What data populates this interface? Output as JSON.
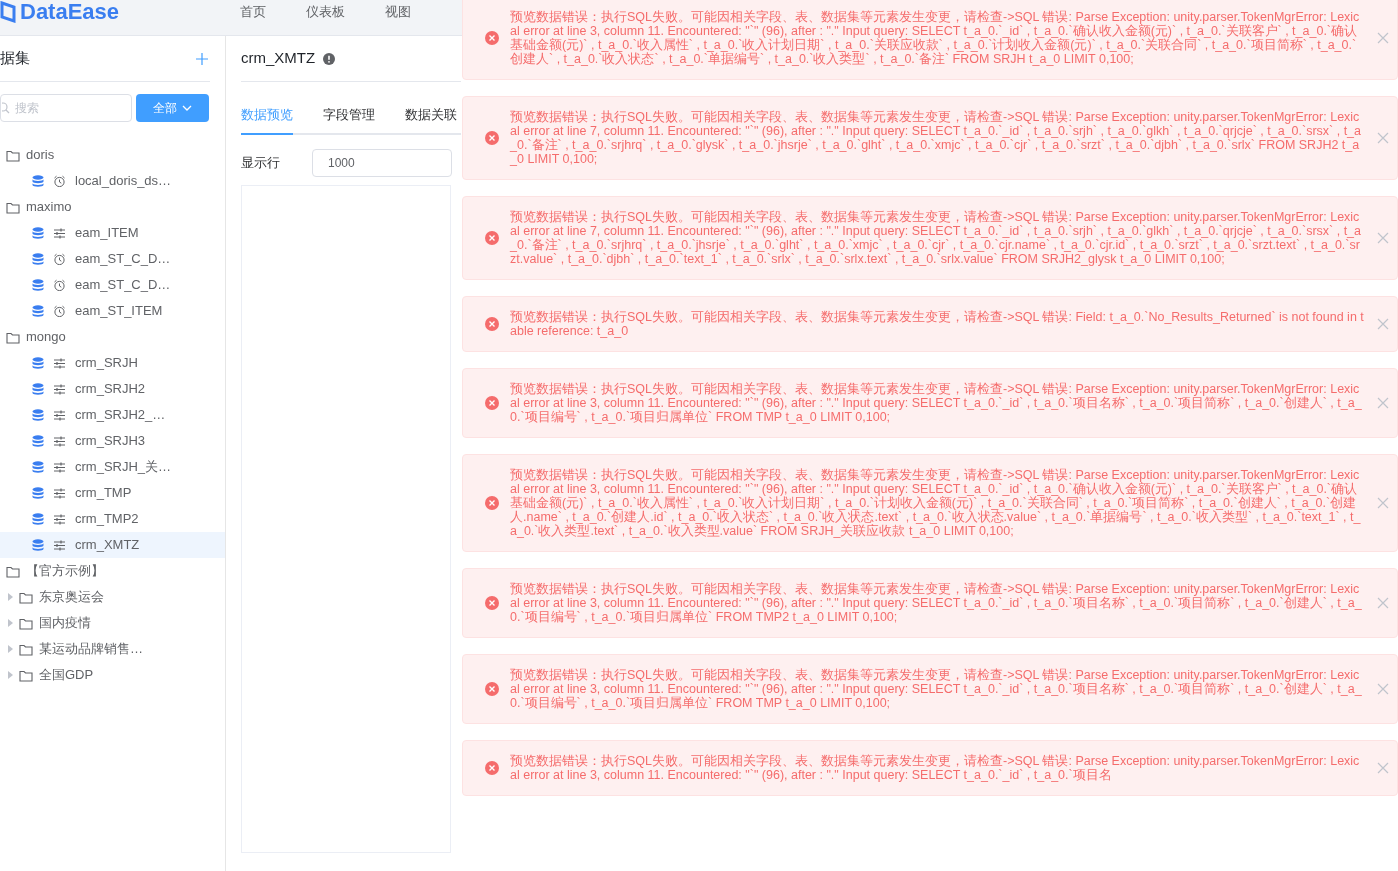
{
  "header": {
    "logo": "DataEase",
    "nav": [
      "首页",
      "仪表板",
      "视图"
    ]
  },
  "sidebar": {
    "title": "据集",
    "search": {
      "placeholder": "搜索"
    },
    "filter_button": "全部",
    "tree": [
      {
        "label": "doris",
        "kind": "folder",
        "children": [
          {
            "label": "local_doris_ds…",
            "kind": "dataset",
            "scheduled": true,
            "selected": false
          }
        ]
      },
      {
        "label": "maximo",
        "kind": "folder",
        "children": [
          {
            "label": "eam_ITEM",
            "kind": "dataset",
            "scheduled": false,
            "selected": false
          },
          {
            "label": "eam_ST_C_D…",
            "kind": "dataset",
            "scheduled": true,
            "selected": false
          },
          {
            "label": "eam_ST_C_D…",
            "kind": "dataset",
            "scheduled": true,
            "selected": false
          },
          {
            "label": "eam_ST_ITEM",
            "kind": "dataset",
            "scheduled": true,
            "selected": false
          }
        ]
      },
      {
        "label": "mongo",
        "kind": "folder",
        "children": [
          {
            "label": "crm_SRJH",
            "kind": "dataset",
            "scheduled": false,
            "selected": false
          },
          {
            "label": "crm_SRJH2",
            "kind": "dataset",
            "scheduled": false,
            "selected": false
          },
          {
            "label": "crm_SRJH2_…",
            "kind": "dataset",
            "scheduled": false,
            "selected": false
          },
          {
            "label": "crm_SRJH3",
            "kind": "dataset",
            "scheduled": false,
            "selected": false
          },
          {
            "label": "crm_SRJH_关…",
            "kind": "dataset",
            "scheduled": false,
            "selected": false
          },
          {
            "label": "crm_TMP",
            "kind": "dataset",
            "scheduled": false,
            "selected": false
          },
          {
            "label": "crm_TMP2",
            "kind": "dataset",
            "scheduled": false,
            "selected": false
          },
          {
            "label": "crm_XMTZ",
            "kind": "dataset",
            "scheduled": false,
            "selected": true
          }
        ]
      },
      {
        "label": "【官方示例】",
        "kind": "folder",
        "children": [
          {
            "label": "东京奥运会",
            "kind": "folder",
            "expanded": false
          },
          {
            "label": "国内疫情",
            "kind": "folder",
            "expanded": false
          },
          {
            "label": "某运动品牌销售…",
            "kind": "folder",
            "expanded": false
          },
          {
            "label": "全国GDP",
            "kind": "folder",
            "expanded": false
          }
        ]
      }
    ]
  },
  "main": {
    "title": "crm_XMTZ",
    "tabs": [
      {
        "label": "数据预览",
        "selected": true
      },
      {
        "label": "字段管理",
        "selected": false
      },
      {
        "label": "数据关联",
        "selected": false
      }
    ],
    "rows_label": "显示行",
    "rows_value": "1000"
  },
  "notifications": [
    {
      "kind": "error",
      "message": "预览数据错误：执行SQL失败。可能因相关字段、表、数据集等元素发生变更，请检查->SQL 错误: Parse Exception: unity.parser.TokenMgrError: Lexical error at line 3, column 11. Encountered: \"`\" (96), after : \".\" Input query: SELECT t_a_0.`_id` , t_a_0.`确认收入金额(元)` , t_a_0.`关联客户` , t_a_0.`确认基础金额(元)` , t_a_0.`收入属性` , t_a_0.`收入计划日期` , t_a_0.`关联应收款` , t_a_0.`计划收入金额(元)` , t_a_0.`关联合同` , t_a_0.`项目简称` , t_a_0.`创建人` , t_a_0.`收入状态` , t_a_0.`单据编号` , t_a_0.`收入类型` , t_a_0.`备注` FROM SRJH t_a_0 LIMIT 0,100;"
    },
    {
      "kind": "error",
      "message": "预览数据错误：执行SQL失败。可能因相关字段、表、数据集等元素发生变更，请检查->SQL 错误: Parse Exception: unity.parser.TokenMgrError: Lexical error at line 7, column 11. Encountered: \"`\" (96), after : \".\" Input query: SELECT t_a_0.`_id` , t_a_0.`srjh` , t_a_0.`glkh` , t_a_0.`qrjcje` , t_a_0.`srsx` , t_a_0.`备注` , t_a_0.`srjhrq` , t_a_0.`glysk` , t_a_0.`jhsrje` , t_a_0.`glht` , t_a_0.`xmjc` , t_a_0.`cjr` , t_a_0.`srzt` , t_a_0.`djbh` , t_a_0.`srlx` FROM SRJH2 t_a_0 LIMIT 0,100;"
    },
    {
      "kind": "error",
      "message": "预览数据错误：执行SQL失败。可能因相关字段、表、数据集等元素发生变更，请检查->SQL 错误: Parse Exception: unity.parser.TokenMgrError: Lexical error at line 7, column 11. Encountered: \"`\" (96), after : \".\" Input query: SELECT t_a_0.`_id` , t_a_0.`srjh` , t_a_0.`glkh` , t_a_0.`qrjcje` , t_a_0.`srsx` , t_a_0.`备注` , t_a_0.`srjhrq` , t_a_0.`jhsrje` , t_a_0.`glht` , t_a_0.`xmjc` , t_a_0.`cjr` , t_a_0.`cjr.name` , t_a_0.`cjr.id` , t_a_0.`srzt` , t_a_0.`srzt.text` , t_a_0.`srzt.value` , t_a_0.`djbh` , t_a_0.`text_1` , t_a_0.`srlx` , t_a_0.`srlx.text` , t_a_0.`srlx.value` FROM SRJH2_glysk t_a_0 LIMIT 0,100;"
    },
    {
      "kind": "error",
      "message": "预览数据错误：执行SQL失败。可能因相关字段、表、数据集等元素发生变更，请检查->SQL 错误: Field: t_a_0.`No_Results_Returned` is not found in table reference: t_a_0"
    },
    {
      "kind": "error",
      "message": "预览数据错误：执行SQL失败。可能因相关字段、表、数据集等元素发生变更，请检查->SQL 错误: Parse Exception: unity.parser.TokenMgrError: Lexical error at line 3, column 11. Encountered: \"`\" (96), after : \".\" Input query: SELECT t_a_0.`_id` , t_a_0.`项目名称` , t_a_0.`项目简称` , t_a_0.`创建人` , t_a_0.`项目编号` , t_a_0.`项目归属单位` FROM TMP t_a_0 LIMIT 0,100;"
    },
    {
      "kind": "error",
      "message": "预览数据错误：执行SQL失败。可能因相关字段、表、数据集等元素发生变更，请检查->SQL 错误: Parse Exception: unity.parser.TokenMgrError: Lexical error at line 3, column 11. Encountered: \"`\" (96), after : \".\" Input query: SELECT t_a_0.`_id` , t_a_0.`确认收入金额(元)` , t_a_0.`关联客户` , t_a_0.`确认基础金额(元)` , t_a_0.`收入属性` , t_a_0.`收入计划日期` , t_a_0.`计划收入金额(元)` , t_a_0.`关联合同` , t_a_0.`项目简称` , t_a_0.`创建人` , t_a_0.`创建人.name` , t_a_0.`创建人.id` , t_a_0.`收入状态` , t_a_0.`收入状态.text` , t_a_0.`收入状态.value` , t_a_0.`单据编号` , t_a_0.`收入类型` , t_a_0.`text_1` , t_a_0.`收入类型.text` , t_a_0.`收入类型.value` FROM SRJH_关联应收款 t_a_0 LIMIT 0,100;"
    },
    {
      "kind": "error",
      "message": "预览数据错误：执行SQL失败。可能因相关字段、表、数据集等元素发生变更，请检查->SQL 错误: Parse Exception: unity.parser.TokenMgrError: Lexical error at line 3, column 11. Encountered: \"`\" (96), after : \".\" Input query: SELECT t_a_0.`_id` , t_a_0.`项目名称` , t_a_0.`项目简称` , t_a_0.`创建人` , t_a_0.`项目编号` , t_a_0.`项目归属单位` FROM TMP2 t_a_0 LIMIT 0,100;"
    },
    {
      "kind": "error",
      "message": "预览数据错误：执行SQL失败。可能因相关字段、表、数据集等元素发生变更，请检查->SQL 错误: Parse Exception: unity.parser.TokenMgrError: Lexical error at line 3, column 11. Encountered: \"`\" (96), after : \".\" Input query: SELECT t_a_0.`_id` , t_a_0.`项目名称` , t_a_0.`项目简称` , t_a_0.`创建人` , t_a_0.`项目编号` , t_a_0.`项目归属单位` FROM TMP t_a_0 LIMIT 0,100;"
    },
    {
      "kind": "error",
      "message": "预览数据错误：执行SQL失败。可能因相关字段、表、数据集等元素发生变更，请检查->SQL 错误: Parse Exception: unity.parser.TokenMgrError: Lexical error at line 3, column 11. Encountered: \"`\" (96), after : \".\" Input query: SELECT t_a_0.`_id` , t_a_0.`项目名"
    }
  ]
}
